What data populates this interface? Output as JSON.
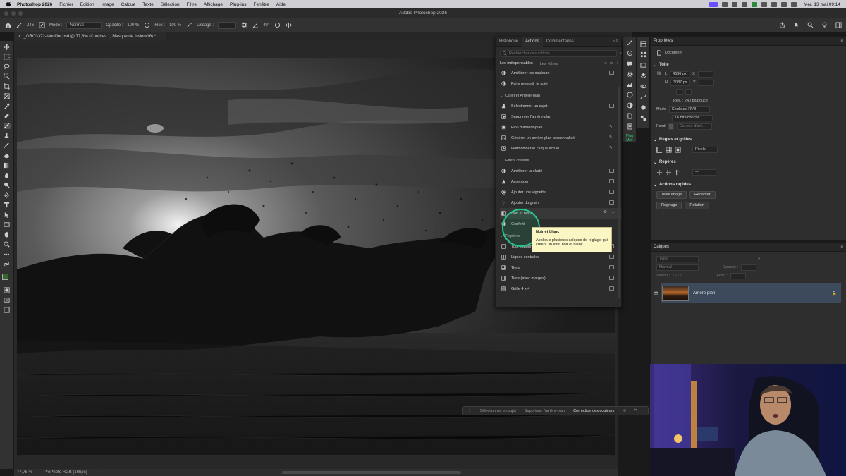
{
  "mac_menu": {
    "app": "Photoshop 2026",
    "items": [
      "Fichier",
      "Edition",
      "Image",
      "Calque",
      "Texte",
      "Sélection",
      "Filtre",
      "Affichage",
      "Plug-ins",
      "Fenêtre",
      "Aide"
    ],
    "clock": "Mer. 13 mai 09:14"
  },
  "window_title": "Adobe Photoshop 2026",
  "options_bar": {
    "brush_size": "246",
    "mode_label": "Mode :",
    "mode_value": "Normal",
    "opacity_label": "Opacité :",
    "opacity_value": "100 %",
    "flow_label": "Flux :",
    "flow_value": "100 %",
    "smoothing_label": "Lissage :",
    "angle_value": "49°"
  },
  "document_tab": "_ORO3372-Modifier.psd @ 77,8% (Courbes 1, Masque de fusion/16) *",
  "status_bar": {
    "zoom": "77,75 %",
    "profile": "ProPhoto RGB (16bpc)"
  },
  "contextual_bar": {
    "items": [
      "Sélectionner un sujet",
      "Supprimer l'arrière-plan",
      "Correction des couleurs"
    ]
  },
  "actions_panel": {
    "tabs": [
      "Historique",
      "Actions",
      "Commentaires"
    ],
    "search_placeholder": "Rechercher des actions",
    "subtabs": [
      "Les indispensables",
      "Les vôtres"
    ],
    "rows_top": [
      "Améliorer les couleurs",
      "Faire ressortir le sujet"
    ],
    "section_objet": "Objet et Arrière-plan",
    "rows_objet": [
      "Sélectionner un sujet",
      "Supprimer l'arrière-plan",
      "Flou d'arrière-plan",
      "Générer un arrière-plan personnalisé",
      "Harmoniser le calque actuel"
    ],
    "section_effets": "Effets créatifs",
    "rows_effets": [
      "Améliorer la clarté",
      "Accentuer",
      "Ajouter une vignette",
      "Ajouter du grain",
      "Noir et blanc",
      "Confetti"
    ],
    "section_reperes": "Repères",
    "rows_reperes": [
      "Tout supprimer",
      "Lignes centrales",
      "Tiers",
      "Tiers (avec marges)",
      "Grille 4 x 4"
    ]
  },
  "tooltip": {
    "title": "Noir et blanc",
    "body": "Applique plusieurs calques de réglage qui créent un effet noir et blanc."
  },
  "properties": {
    "title": "Propriétés",
    "doc_label": "Document",
    "canvas_section": "Toile",
    "width_label": "L",
    "width_value": "4630 px",
    "height_label": "H",
    "height_value": "3087 px",
    "x_label": "X",
    "y_label": "Y",
    "resolution": "Rés. : 240 px/pouce",
    "mode_label": "Mode",
    "mode_value": "Couleurs RVB",
    "depth_value": "16 bits/couche",
    "fond_label": "Fond",
    "fond_value": "Couleur d'arri...",
    "rulers_section": "Règles et grilles",
    "units_value": "Pixels",
    "guides_section": "Repères",
    "quick_section": "Actions rapides",
    "quick_buttons": [
      "Taille image",
      "Recadrer",
      "Rognage",
      "Rotation"
    ]
  },
  "layers": {
    "title": "Calques",
    "search_placeholder": "Type",
    "blend_value": "Normal",
    "opacity_label": "Opacité :",
    "lock_label": "Verrou :",
    "fill_label": "Fond :",
    "layer_name": "Arrière-plan"
  },
  "mid_strip": {
    "label": "Plug Mixr"
  }
}
